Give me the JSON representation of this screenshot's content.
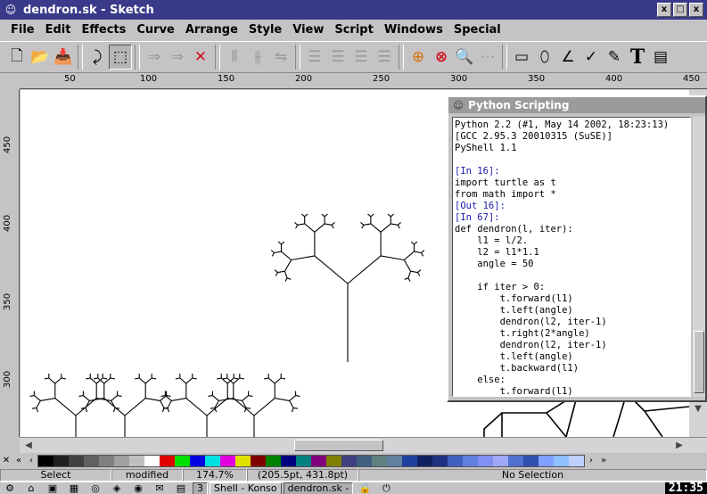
{
  "window": {
    "title": "dendron.sk - Sketch",
    "controls": [
      "x",
      "□",
      "x"
    ]
  },
  "menu": [
    "File",
    "Edit",
    "Effects",
    "Curve",
    "Arrange",
    "Style",
    "View",
    "Script",
    "Windows",
    "Special"
  ],
  "toolbar": {
    "text_tool_glyph": "T"
  },
  "hruler": [
    "50",
    "100",
    "150",
    "200",
    "250",
    "300",
    "350",
    "400",
    "450"
  ],
  "vruler": [
    "450",
    "400",
    "350",
    "300"
  ],
  "palette_colors": [
    "#000000",
    "#202020",
    "#404040",
    "#606060",
    "#808080",
    "#a0a0a0",
    "#c0c0c0",
    "#ffffff",
    "#e00000",
    "#00e000",
    "#0000e0",
    "#00e0e0",
    "#e000e0",
    "#e0e000",
    "#800000",
    "#008000",
    "#000080",
    "#008080",
    "#800080",
    "#808000",
    "#404080",
    "#406080",
    "#608080",
    "#6080a0",
    "#2040a0",
    "#102060",
    "#203080",
    "#4060c0",
    "#6080e0",
    "#8090f0",
    "#a0a8f8",
    "#5070d0",
    "#3050b0",
    "#80a0ff",
    "#90c0ff",
    "#c0d0ff"
  ],
  "status": {
    "mode": "Select",
    "modified": "modified",
    "zoom": "174.7%",
    "coords": "(205.5pt, 431.8pt)",
    "selection": "No Selection"
  },
  "taskbar": {
    "desktop": "3",
    "tasks": [
      "Shell - Konso",
      "dendron.sk -"
    ],
    "clock": "21:35"
  },
  "python": {
    "title": "Python Scripting",
    "lines": [
      {
        "t": "Python 2.2 (#1, May 14 2002, 18:23:13)",
        "p": false
      },
      {
        "t": "[GCC 2.95.3 20010315 (SuSE)]",
        "p": false
      },
      {
        "t": "PyShell 1.1",
        "p": false
      },
      {
        "t": "",
        "p": false
      },
      {
        "t": "[In 16]:",
        "p": true
      },
      {
        "t": "import turtle as t",
        "p": false
      },
      {
        "t": "from math import *",
        "p": false
      },
      {
        "t": "[Out 16]:",
        "p": true
      },
      {
        "t": "[In 67]:",
        "p": true
      },
      {
        "t": "def dendron(l, iter):",
        "p": false
      },
      {
        "t": "    l1 = l/2.",
        "p": false
      },
      {
        "t": "    l2 = l1*1.1",
        "p": false
      },
      {
        "t": "    angle = 50",
        "p": false
      },
      {
        "t": "",
        "p": false
      },
      {
        "t": "    if iter > 0:",
        "p": false
      },
      {
        "t": "        t.forward(l1)",
        "p": false
      },
      {
        "t": "        t.left(angle)",
        "p": false
      },
      {
        "t": "        dendron(l2, iter-1)",
        "p": false
      },
      {
        "t": "        t.right(2*angle)",
        "p": false
      },
      {
        "t": "        dendron(l2, iter-1)",
        "p": false
      },
      {
        "t": "        t.left(angle)",
        "p": false
      },
      {
        "t": "        t.backward(l1)",
        "p": false
      },
      {
        "t": "    else:",
        "p": false
      },
      {
        "t": "        t.forward(l1)",
        "p": false
      }
    ]
  }
}
